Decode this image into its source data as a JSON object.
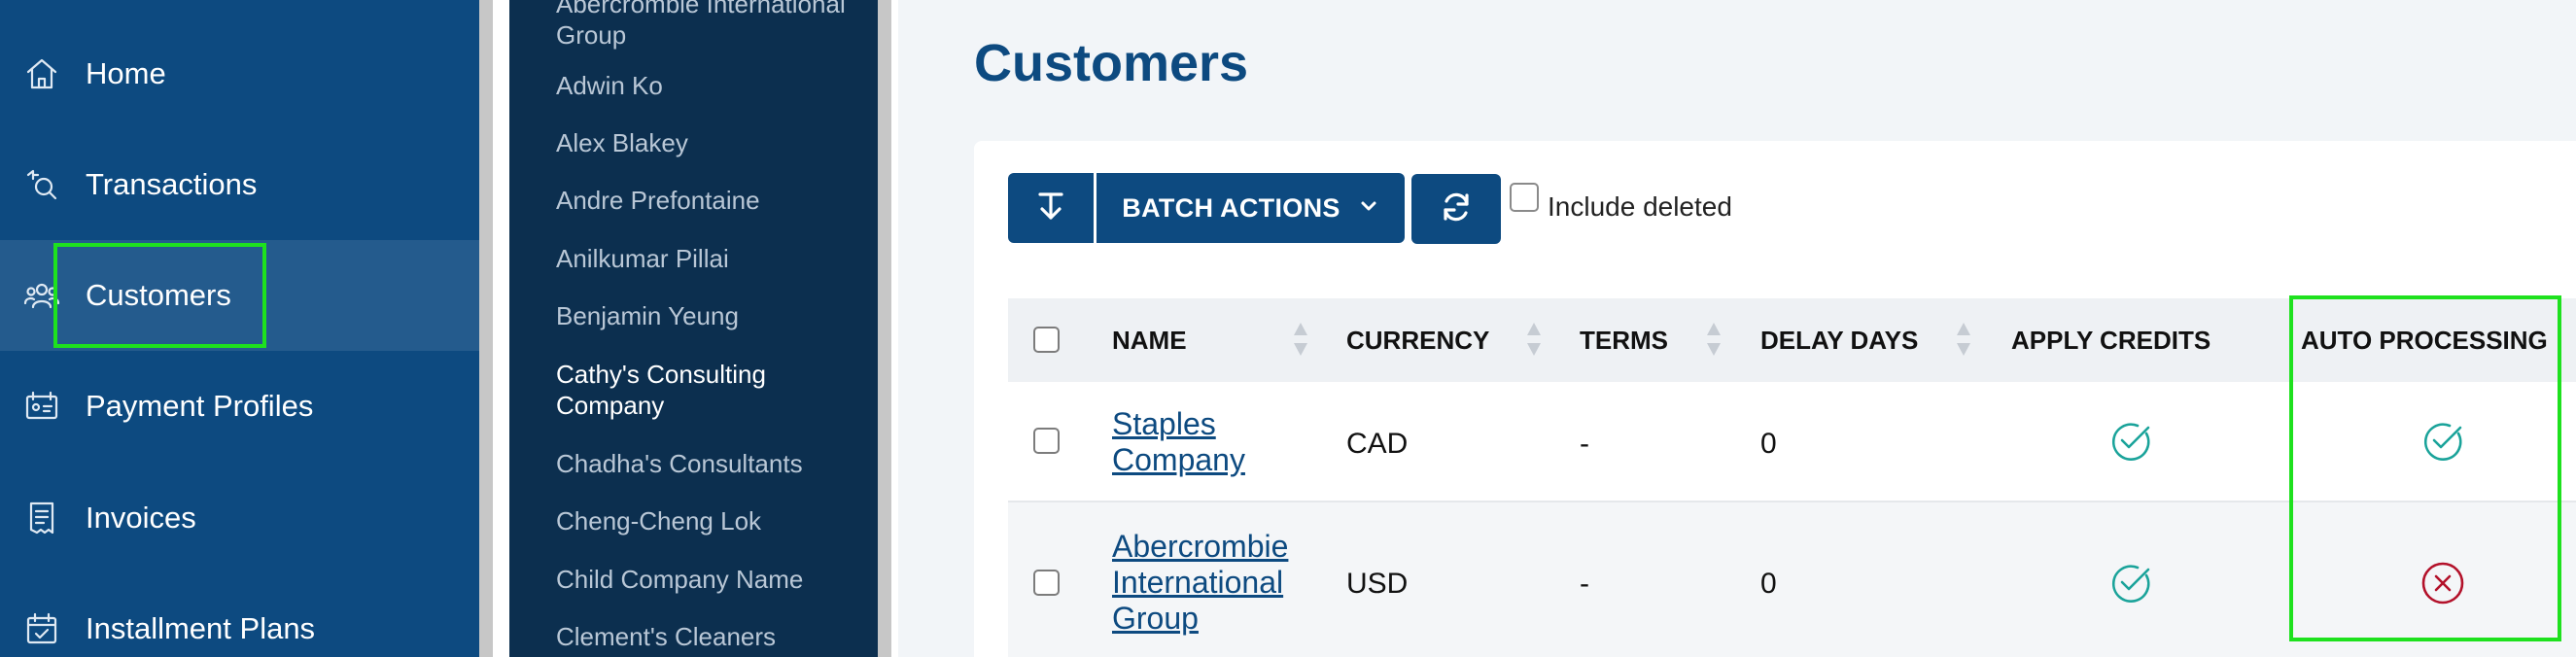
{
  "nav": {
    "items": [
      {
        "label": "Home",
        "icon": "home-icon"
      },
      {
        "label": "Transactions",
        "icon": "transactions-icon"
      },
      {
        "label": "Customers",
        "icon": "customers-icon",
        "active": true
      },
      {
        "label": "Payment Profiles",
        "icon": "payment-profiles-icon"
      },
      {
        "label": "Invoices",
        "icon": "invoices-icon"
      },
      {
        "label": "Installment Plans",
        "icon": "installment-plans-icon"
      }
    ]
  },
  "customer_list": {
    "items": [
      "Abercrombie International Group",
      "Adwin Ko",
      "Alex Blakey",
      "Andre Prefontaine",
      "Anilkumar Pillai",
      "Benjamin Yeung",
      "Cathy's Consulting Company",
      "Chadha's Consultants",
      "Cheng-Cheng Lok",
      "Child Company Name",
      "Clement's Cleaners"
    ],
    "current": "Cathy's Consulting Company"
  },
  "main": {
    "title": "Customers",
    "toolbar": {
      "batch_actions_label": "BATCH ACTIONS",
      "include_deleted_label": "Include deleted",
      "include_deleted_checked": false
    },
    "table": {
      "columns": [
        "NAME",
        "CURRENCY",
        "TERMS",
        "DELAY DAYS",
        "APPLY CREDITS",
        "AUTO PROCESSING"
      ],
      "rows": [
        {
          "name": "Staples Company",
          "currency": "CAD",
          "terms": "-",
          "delay_days": "0",
          "apply_credits": true,
          "auto_processing": true
        },
        {
          "name": "Abercrombie International Group",
          "currency": "USD",
          "terms": "-",
          "delay_days": "0",
          "apply_credits": true,
          "auto_processing": false
        }
      ]
    }
  },
  "colors": {
    "nav_bg": "#0d4a80",
    "accent": "#0d4a80",
    "check_teal": "#1aa39a",
    "cross_red": "#b3112a",
    "highlight_green": "#1ee11e"
  }
}
